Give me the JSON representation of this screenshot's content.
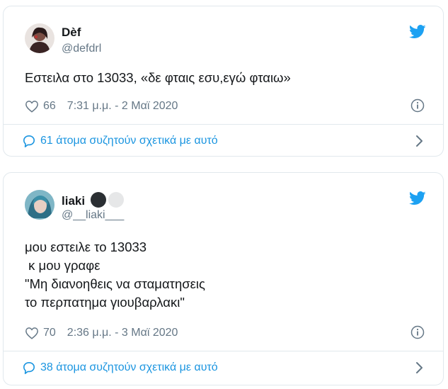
{
  "tweets": [
    {
      "name": "Dèf",
      "handle": "@defdrl",
      "text": "Εστειλα στο 13033, «δε φταις εσυ,εγώ φταιω»",
      "likes": "66",
      "timestamp": "7:31 μ.μ. - 2 Μαϊ 2020",
      "conversation": "61 άτομα συζητούν σχετικά με αυτό",
      "avatar_color": "#6b3a3a"
    },
    {
      "name": "liaki",
      "handle": "@__liaki___",
      "text_lines": [
        "μου εστειλε το 13033",
        " κ μου γραφε",
        "\"Μη διανοηθεις να σταματησεις",
        "το περπατημα γιουβαρλακι\""
      ],
      "likes": "70",
      "timestamp": "2:36 μ.μ. - 3 Μαϊ 2020",
      "conversation": "38 άτομα συζητούν σχετικά με αυτό",
      "avatar_color": "#4aa0b8",
      "name_emoji": [
        "black-circle",
        "white-circle"
      ]
    }
  ],
  "icons": {
    "twitter": "twitter-bird-icon",
    "like": "heart-icon",
    "info": "info-icon",
    "conversation": "speech-bubble-icon",
    "chevron": "chevron-right-icon"
  },
  "colors": {
    "twitter_blue": "#1da1f2",
    "link_blue": "#1b95e0",
    "secondary_text": "#657786",
    "border": "#e1e8ed"
  }
}
